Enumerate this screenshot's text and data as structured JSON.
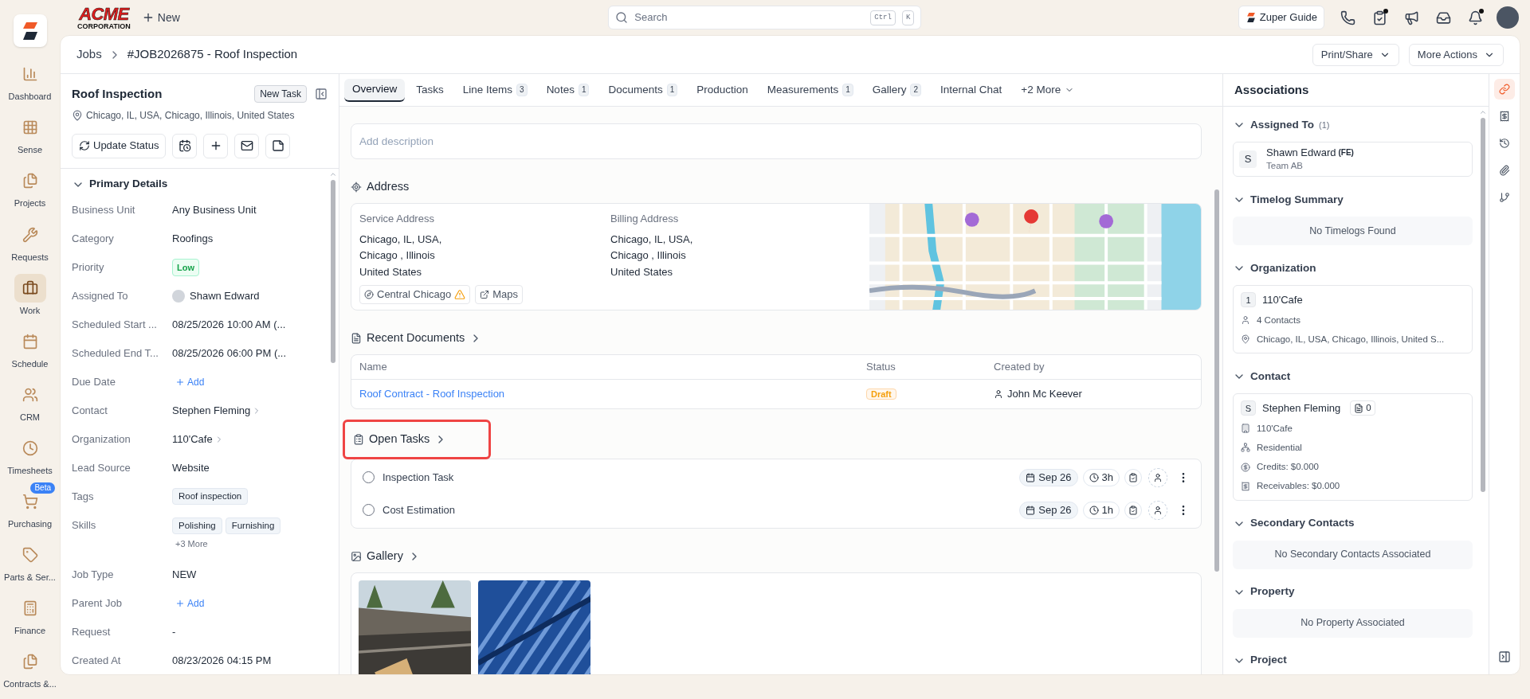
{
  "brand": {
    "name": "ACME",
    "tagline": "CORPORATION"
  },
  "topbar": {
    "new_label": "New",
    "search": {
      "placeholder": "Search",
      "keys": [
        "Ctrl",
        "K"
      ]
    },
    "guide": "Zuper Guide",
    "icons": [
      {
        "dot": false
      },
      {
        "dot": true
      },
      {
        "dot": false
      },
      {
        "dot": false
      },
      {
        "dot": true
      }
    ]
  },
  "nav": [
    {
      "label": "Dashboard",
      "selected": false
    },
    {
      "label": "Sense",
      "selected": false
    },
    {
      "label": "Projects",
      "selected": false
    },
    {
      "label": "Requests",
      "selected": false
    },
    {
      "label": "Work",
      "selected": true
    },
    {
      "label": "Schedule",
      "selected": false
    },
    {
      "label": "CRM",
      "selected": false
    },
    {
      "label": "Timesheets",
      "selected": false
    },
    {
      "label": "Purchasing",
      "selected": false,
      "badge": "Beta"
    },
    {
      "label": "Parts & Ser...",
      "selected": false
    },
    {
      "label": "Finance",
      "selected": false
    },
    {
      "label": "Contracts &...",
      "selected": false
    }
  ],
  "breadcrumb": [
    "Jobs",
    "#JOB2026875 - Roof Inspection"
  ],
  "header_actions": [
    "Print/Share",
    "More Actions"
  ],
  "job": {
    "title": "Roof Inspection",
    "new_task": "New Task",
    "location": "Chicago, IL, USA, Chicago, Illinois, United States",
    "update_status": "Update Status"
  },
  "primary_details": {
    "title": "Primary Details",
    "expanded": true,
    "rows": [
      {
        "label": "Business Unit",
        "kind": "text",
        "value": "Any Business Unit"
      },
      {
        "label": "Category",
        "kind": "text",
        "value": "Roofings"
      },
      {
        "label": "Priority",
        "kind": "badge",
        "value": "Low"
      },
      {
        "label": "Assigned To",
        "kind": "user",
        "value": "Shawn Edward"
      },
      {
        "label": "Scheduled Start ...",
        "kind": "text",
        "value": "08/25/2026 10:00 AM (..."
      },
      {
        "label": "Scheduled End T...",
        "kind": "text",
        "value": "08/25/2026 06:00 PM (..."
      },
      {
        "label": "Due Date",
        "kind": "add",
        "value": "Add"
      },
      {
        "label": "Contact",
        "kind": "link",
        "value": "Stephen Fleming"
      },
      {
        "label": "Organization",
        "kind": "link",
        "value": "110'Cafe"
      },
      {
        "label": "Lead Source",
        "kind": "text",
        "value": "Website"
      },
      {
        "label": "Tags",
        "kind": "tags",
        "tags": [
          "Roof inspection"
        ]
      },
      {
        "label": "Skills",
        "kind": "tags",
        "tags": [
          "Polishing",
          "Furnishing"
        ],
        "more": "+3 More"
      },
      {
        "label": "Job Type",
        "kind": "text",
        "value": "NEW"
      },
      {
        "label": "Parent Job",
        "kind": "add",
        "value": "Add"
      },
      {
        "label": "Request",
        "kind": "text",
        "value": "-"
      },
      {
        "label": "Created At",
        "kind": "text",
        "value": "08/23/2026 04:15 PM"
      }
    ]
  },
  "tabs": [
    {
      "label": "Overview",
      "selected": true
    },
    {
      "label": "Tasks",
      "selected": false
    },
    {
      "label": "Line Items",
      "count": "3",
      "selected": false
    },
    {
      "label": "Notes",
      "count": "1",
      "selected": false
    },
    {
      "label": "Documents",
      "count": "1",
      "selected": false
    },
    {
      "label": "Production",
      "selected": false
    },
    {
      "label": "Measurements",
      "count": "1",
      "selected": false
    },
    {
      "label": "Gallery",
      "count": "2",
      "selected": false
    },
    {
      "label": "Internal Chat",
      "selected": false
    },
    {
      "label": "+2 More",
      "selected": false
    }
  ],
  "description": {
    "placeholder": "Add description"
  },
  "address": {
    "title": "Address",
    "service": {
      "label": "Service Address",
      "lines": [
        "Chicago, IL, USA,",
        "Chicago , Illinois",
        "United States"
      ]
    },
    "billing": {
      "label": "Billing Address",
      "lines": [
        "Chicago, IL, USA,",
        "Chicago , Illinois",
        "United States"
      ]
    },
    "zone": "Central Chicago",
    "zone_warning": true,
    "maps": "Maps"
  },
  "recent_documents": {
    "title": "Recent Documents",
    "columns": [
      "Name",
      "Status",
      "Created by"
    ],
    "rows": [
      {
        "name": "Roof Contract - Roof Inspection",
        "status": "Draft",
        "created_by": "John Mc Keever"
      }
    ]
  },
  "open_tasks": {
    "title": "Open Tasks",
    "highlighted": true,
    "tasks": [
      {
        "name": "Inspection Task",
        "checked": false,
        "date": "Sep 26",
        "duration": "3h"
      },
      {
        "name": "Cost Estimation",
        "checked": false,
        "date": "Sep 26",
        "duration": "1h"
      }
    ]
  },
  "gallery": {
    "title": "Gallery"
  },
  "associations": {
    "title": "Associations",
    "sections": [
      {
        "title": "Assigned To",
        "count": "(1)",
        "expanded": true,
        "kind": "person",
        "initial": "S",
        "name": "Shawn Edward",
        "role": "(FE)",
        "team": "Team AB"
      },
      {
        "title": "Timelog Summary",
        "expanded": true,
        "kind": "empty",
        "text": "No Timelogs Found"
      },
      {
        "title": "Organization",
        "expanded": true,
        "kind": "org",
        "initial": "1",
        "name": "110'Cafe",
        "contacts": "4 Contacts",
        "address": "Chicago, IL, USA, Chicago, Illinois, United S..."
      },
      {
        "title": "Contact",
        "expanded": true,
        "kind": "contact",
        "initial": "S",
        "name": "Stephen Fleming",
        "doc_count": "0",
        "lines": [
          "110'Cafe",
          "Residential",
          "Credits: $0.000",
          "Receivables: $0.000"
        ]
      },
      {
        "title": "Secondary Contacts",
        "expanded": true,
        "kind": "empty",
        "text": "No Secondary Contacts Associated"
      },
      {
        "title": "Property",
        "expanded": true,
        "kind": "empty",
        "text": "No Property Associated"
      },
      {
        "title": "Project",
        "expanded": true,
        "kind": "header"
      }
    ]
  },
  "rail": [
    {
      "selected": true
    },
    {
      "selected": false
    },
    {
      "selected": false
    },
    {
      "selected": false
    },
    {
      "selected": false
    }
  ]
}
